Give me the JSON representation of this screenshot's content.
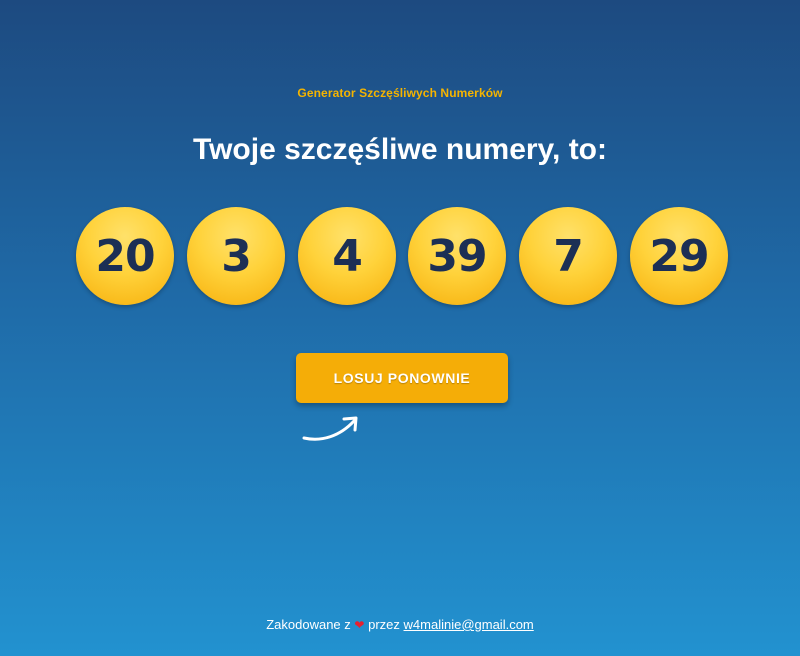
{
  "header": {
    "subtitle": "Generator Szczęśliwych Numerków",
    "headline": "Twoje szczęśliwe numery, to:"
  },
  "numbers": [
    "20",
    "3",
    "4",
    "39",
    "7",
    "29"
  ],
  "actions": {
    "redraw_label": "LOSUJ PONOWNIE"
  },
  "footer": {
    "prefix": "Zakodowane z",
    "heart": "❤",
    "middle": "przez",
    "email": "w4malinie@gmail.com"
  },
  "colors": {
    "accent": "#f5ad07",
    "ball_text": "#1c2f55",
    "background_top": "#1d4a80",
    "background_bottom": "#2292d0"
  },
  "icons": {
    "arrow": "curved-arrow-icon",
    "heart": "heart-icon"
  }
}
